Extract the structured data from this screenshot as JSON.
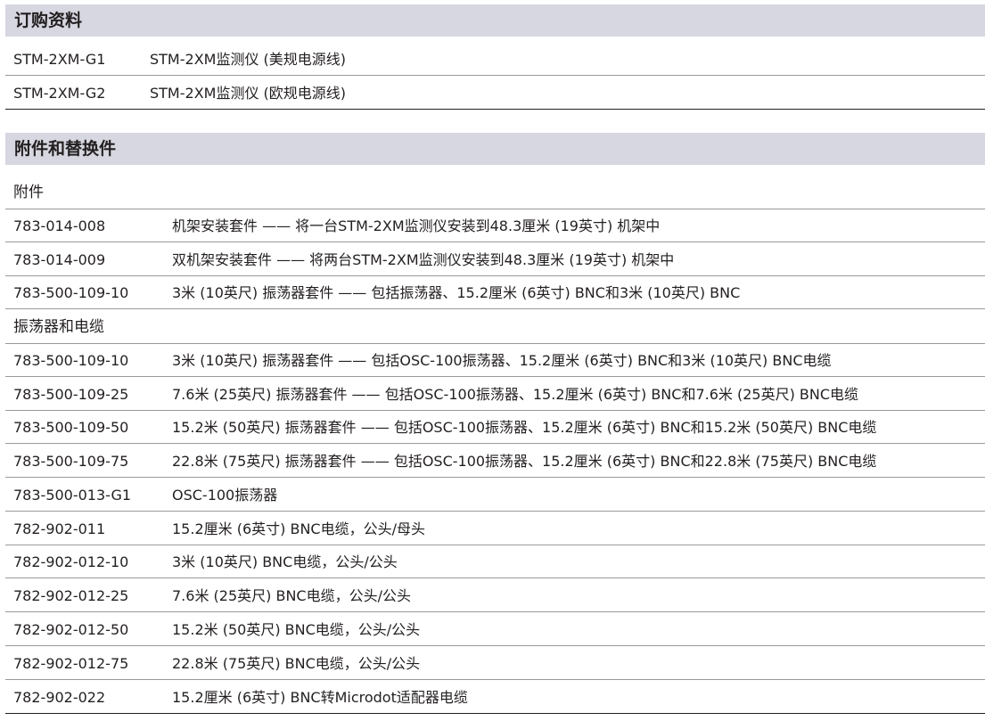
{
  "ordering": {
    "title": "订购资料",
    "rows": [
      {
        "code": "STM-2XM-G1",
        "desc": "STM-2XM监测仪 (美规电源线)"
      },
      {
        "code": "STM-2XM-G2",
        "desc": "STM-2XM监测仪 (欧规电源线)"
      }
    ]
  },
  "accessories": {
    "title": "附件和替换件",
    "groups": [
      {
        "label": "附件",
        "rows": [
          {
            "code": "783-014-008",
            "desc": "机架安装套件 —— 将一台STM-2XM监测仪安装到48.3厘米 (19英寸) 机架中"
          },
          {
            "code": "783-014-009",
            "desc": "双机架安装套件 —— 将两台STM-2XM监测仪安装到48.3厘米 (19英寸) 机架中"
          },
          {
            "code": "783-500-109-10",
            "desc": "3米 (10英尺) 振荡器套件 —— 包括振荡器、15.2厘米 (6英寸) BNC和3米 (10英尺) BNC"
          }
        ]
      },
      {
        "label": "振荡器和电缆",
        "rows": [
          {
            "code": "783-500-109-10",
            "desc": "3米 (10英尺) 振荡器套件 —— 包括OSC-100振荡器、15.2厘米 (6英寸) BNC和3米 (10英尺) BNC电缆"
          },
          {
            "code": "783-500-109-25",
            "desc": "7.6米 (25英尺) 振荡器套件 —— 包括OSC-100振荡器、15.2厘米 (6英寸) BNC和7.6米 (25英尺) BNC电缆"
          },
          {
            "code": "783-500-109-50",
            "desc": "15.2米 (50英尺) 振荡器套件 —— 包括OSC-100振荡器、15.2厘米 (6英寸) BNC和15.2米 (50英尺) BNC电缆"
          },
          {
            "code": "783-500-109-75",
            "desc": "22.8米 (75英尺) 振荡器套件 —— 包括OSC-100振荡器、15.2厘米 (6英寸) BNC和22.8米 (75英尺) BNC电缆"
          },
          {
            "code": "783-500-013-G1",
            "desc": "OSC-100振荡器"
          },
          {
            "code": "782-902-011",
            "desc": "15.2厘米 (6英寸) BNC电缆，公头/母头"
          },
          {
            "code": "782-902-012-10",
            "desc": "3米 (10英尺) BNC电缆，公头/公头"
          },
          {
            "code": "782-902-012-25",
            "desc": "7.6米 (25英尺) BNC电缆，公头/公头"
          },
          {
            "code": "782-902-012-50",
            "desc": "15.2米 (50英尺) BNC电缆，公头/公头"
          },
          {
            "code": "782-902-012-75",
            "desc": "22.8米 (75英尺) BNC电缆，公头/公头"
          },
          {
            "code": "782-902-022",
            "desc": "15.2厘米 (6英寸) BNC转Microdot适配器电缆"
          }
        ]
      }
    ]
  }
}
